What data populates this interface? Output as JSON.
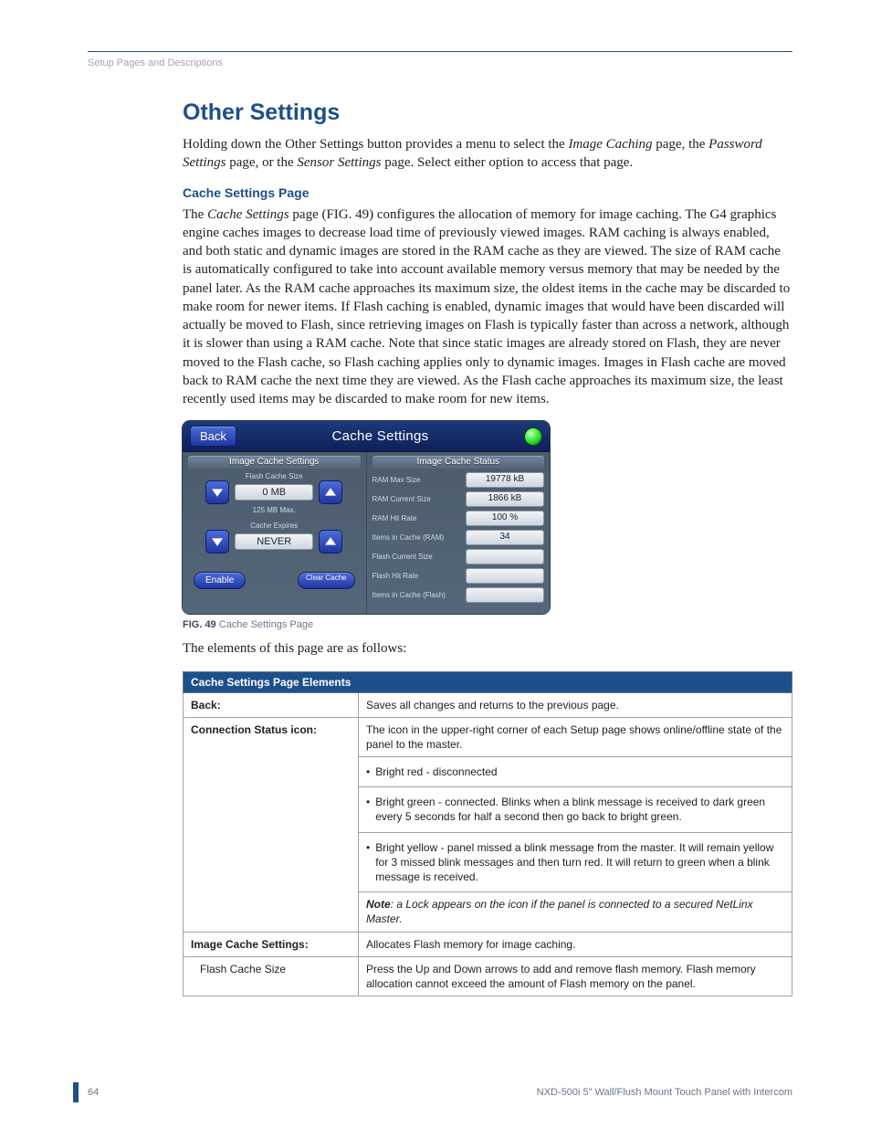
{
  "breadcrumb": "Setup Pages and Descriptions",
  "title": "Other Settings",
  "intro": {
    "pre": "Holding down the Other Settings button provides a menu to select the ",
    "i1": "Image Caching",
    "mid1": " page, the ",
    "i2": "Password Settings",
    "mid2": " page, or the ",
    "i3": "Sensor Settings",
    "post": " page. Select either option to access that page."
  },
  "section_heading": "Cache Settings Page",
  "para": {
    "pre": "The ",
    "em": "Cache Settings",
    "post": " page (FIG. 49) configures the allocation of memory for image caching. The G4 graphics engine caches images to decrease load time of previously viewed images. RAM caching is always enabled, and both static and dynamic images are stored in the RAM cache as they are viewed. The size of RAM cache is automatically configured to take into account available memory versus memory that may be needed by the panel later. As the RAM cache approaches its maximum size, the oldest items in the cache may be discarded to make room for newer items. If Flash caching is enabled, dynamic images that would have been discarded will actually be moved to Flash, since retrieving images on Flash is typically faster than across a network, although it is slower than using a RAM cache. Note that since static images are already stored on Flash, they are never moved to the Flash cache, so Flash caching applies only to dynamic images. Images in Flash cache are moved back to RAM cache the next time they are viewed. As the Flash cache approaches its maximum size, the least recently used items may be discarded to make room for new items."
  },
  "figure": {
    "back_label": "Back",
    "title": "Cache Settings",
    "left_header": "Image Cache Settings",
    "right_header": "Image Cache Status",
    "flash_size_label": "Flash Cache Size",
    "flash_size_value": "0 MB",
    "flash_size_hint": "125 MB Max.",
    "cache_expires_label": "Cache Expires",
    "cache_expires_value": "NEVER",
    "enable_label": "Enable",
    "clear_label": "Clear Cache",
    "status": [
      {
        "label": "RAM Max Size",
        "value": "19778 kB"
      },
      {
        "label": "RAM Current Size",
        "value": "1866 kB"
      },
      {
        "label": "RAM Hit Rate",
        "value": "100 %"
      },
      {
        "label": "Items in Cache (RAM)",
        "value": "34"
      },
      {
        "label": "Flash Current Size",
        "value": ""
      },
      {
        "label": "Flash Hit Rate",
        "value": ""
      },
      {
        "label": "Items in Cache (Flash)",
        "value": ""
      }
    ]
  },
  "fig_caption_b": "FIG. 49",
  "fig_caption_t": "  Cache Settings Page",
  "lead_out": "The elements of this page are as follows:",
  "table": {
    "header": "Cache Settings Page Elements",
    "rows": {
      "back_l": "Back:",
      "back_d": "Saves all changes and returns to the previous page.",
      "conn_l": "Connection Status icon:",
      "conn_d1": "The icon in the upper-right corner of each Setup page shows online/offline state of the panel to the master.",
      "conn_b1": "Bright red - disconnected",
      "conn_b2": "Bright green - connected. Blinks when a blink message is received to dark green every 5 seconds for half a second then go back to bright green.",
      "conn_b3": "Bright yellow - panel missed a blink message from the master. It will remain yellow for 3 missed blink messages and then turn red. It will return to green when a blink message is received.",
      "conn_note_b": "Note",
      "conn_note_t": ": a Lock appears on the icon if the panel is connected to a secured NetLinx Master.",
      "ics_l": "Image Cache Settings:",
      "ics_d": "Allocates Flash memory for image caching.",
      "fcs_l": "Flash Cache Size",
      "fcs_d": "Press the Up and Down arrows to add and remove flash memory. Flash memory allocation cannot exceed the amount of Flash memory on the panel."
    }
  },
  "footer": {
    "page": "64",
    "doc": "NXD-500i 5\" Wall/Flush Mount Touch Panel with Intercom"
  }
}
